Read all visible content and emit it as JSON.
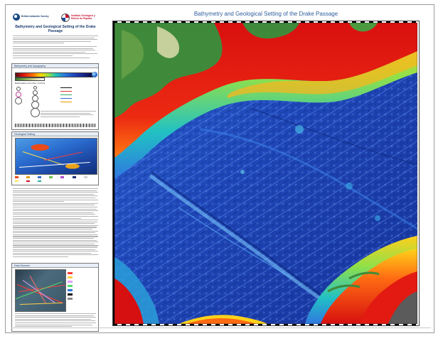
{
  "organisations": {
    "left_name": "British Antarctic Survey",
    "right_name": "Instituto Geológico y Minero de España"
  },
  "side": {
    "title": "Bathymetry and Geological Setting of the Drake Passage",
    "bathy_panel_title": "Bathymetry and topography",
    "earthquake_heading": "Earthquakes and other symbols",
    "geo_panel_title": "Geological Setting",
    "data_panel_title": "Data Sources"
  },
  "map": {
    "title": "Bathymetry and Geological Setting of the Drake Passage",
    "colors": {
      "deep": "#1d3fb5",
      "mid": "#2f7fe0",
      "shallow": "#f2c21a",
      "shelf": "#e41a12",
      "land": "#3f8a3a"
    }
  },
  "icons": [
    "globe-icon",
    "bas-logo",
    "igme-logo"
  ]
}
